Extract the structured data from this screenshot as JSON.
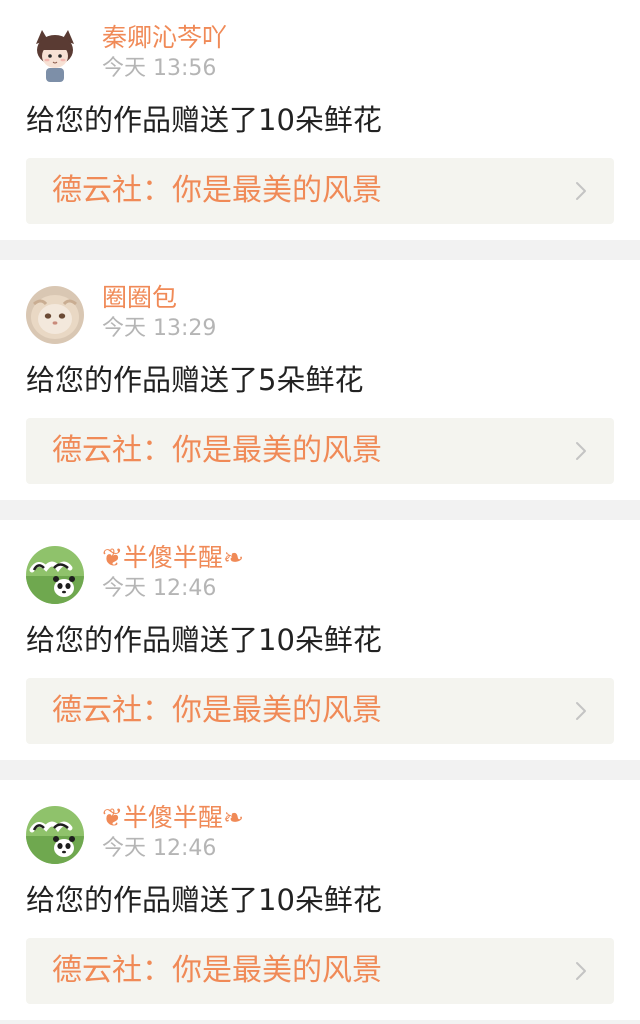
{
  "notifications": [
    {
      "username": "秦卿沁芩吖",
      "time": "今天 13:56",
      "message": "给您的作品赠送了10朵鲜花",
      "work_title": "德云社：你是最美的风景",
      "avatar_icon": "cartoon-cat-girl-avatar"
    },
    {
      "username": "圈圈包",
      "time": "今天 13:29",
      "message": "给您的作品赠送了5朵鲜花",
      "work_title": "德云社：你是最美的风景",
      "avatar_icon": "kitten-photo-avatar"
    },
    {
      "username": "❦半傻半醒❧",
      "time": "今天 12:46",
      "message": "给您的作品赠送了10朵鲜花",
      "work_title": "德云社：你是最美的风景",
      "avatar_icon": "panda-slogan-avatar"
    },
    {
      "username": "❦半傻半醒❧",
      "time": "今天 12:46",
      "message": "给您的作品赠送了10朵鲜花",
      "work_title": "德云社：你是最美的风景",
      "avatar_icon": "panda-slogan-avatar"
    }
  ],
  "colors": {
    "accent": "#f08a57",
    "muted": "#b5b5b5",
    "card_bg": "#ffffff",
    "link_bg": "#f4f4ef",
    "page_bg": "#f2f2f2"
  }
}
